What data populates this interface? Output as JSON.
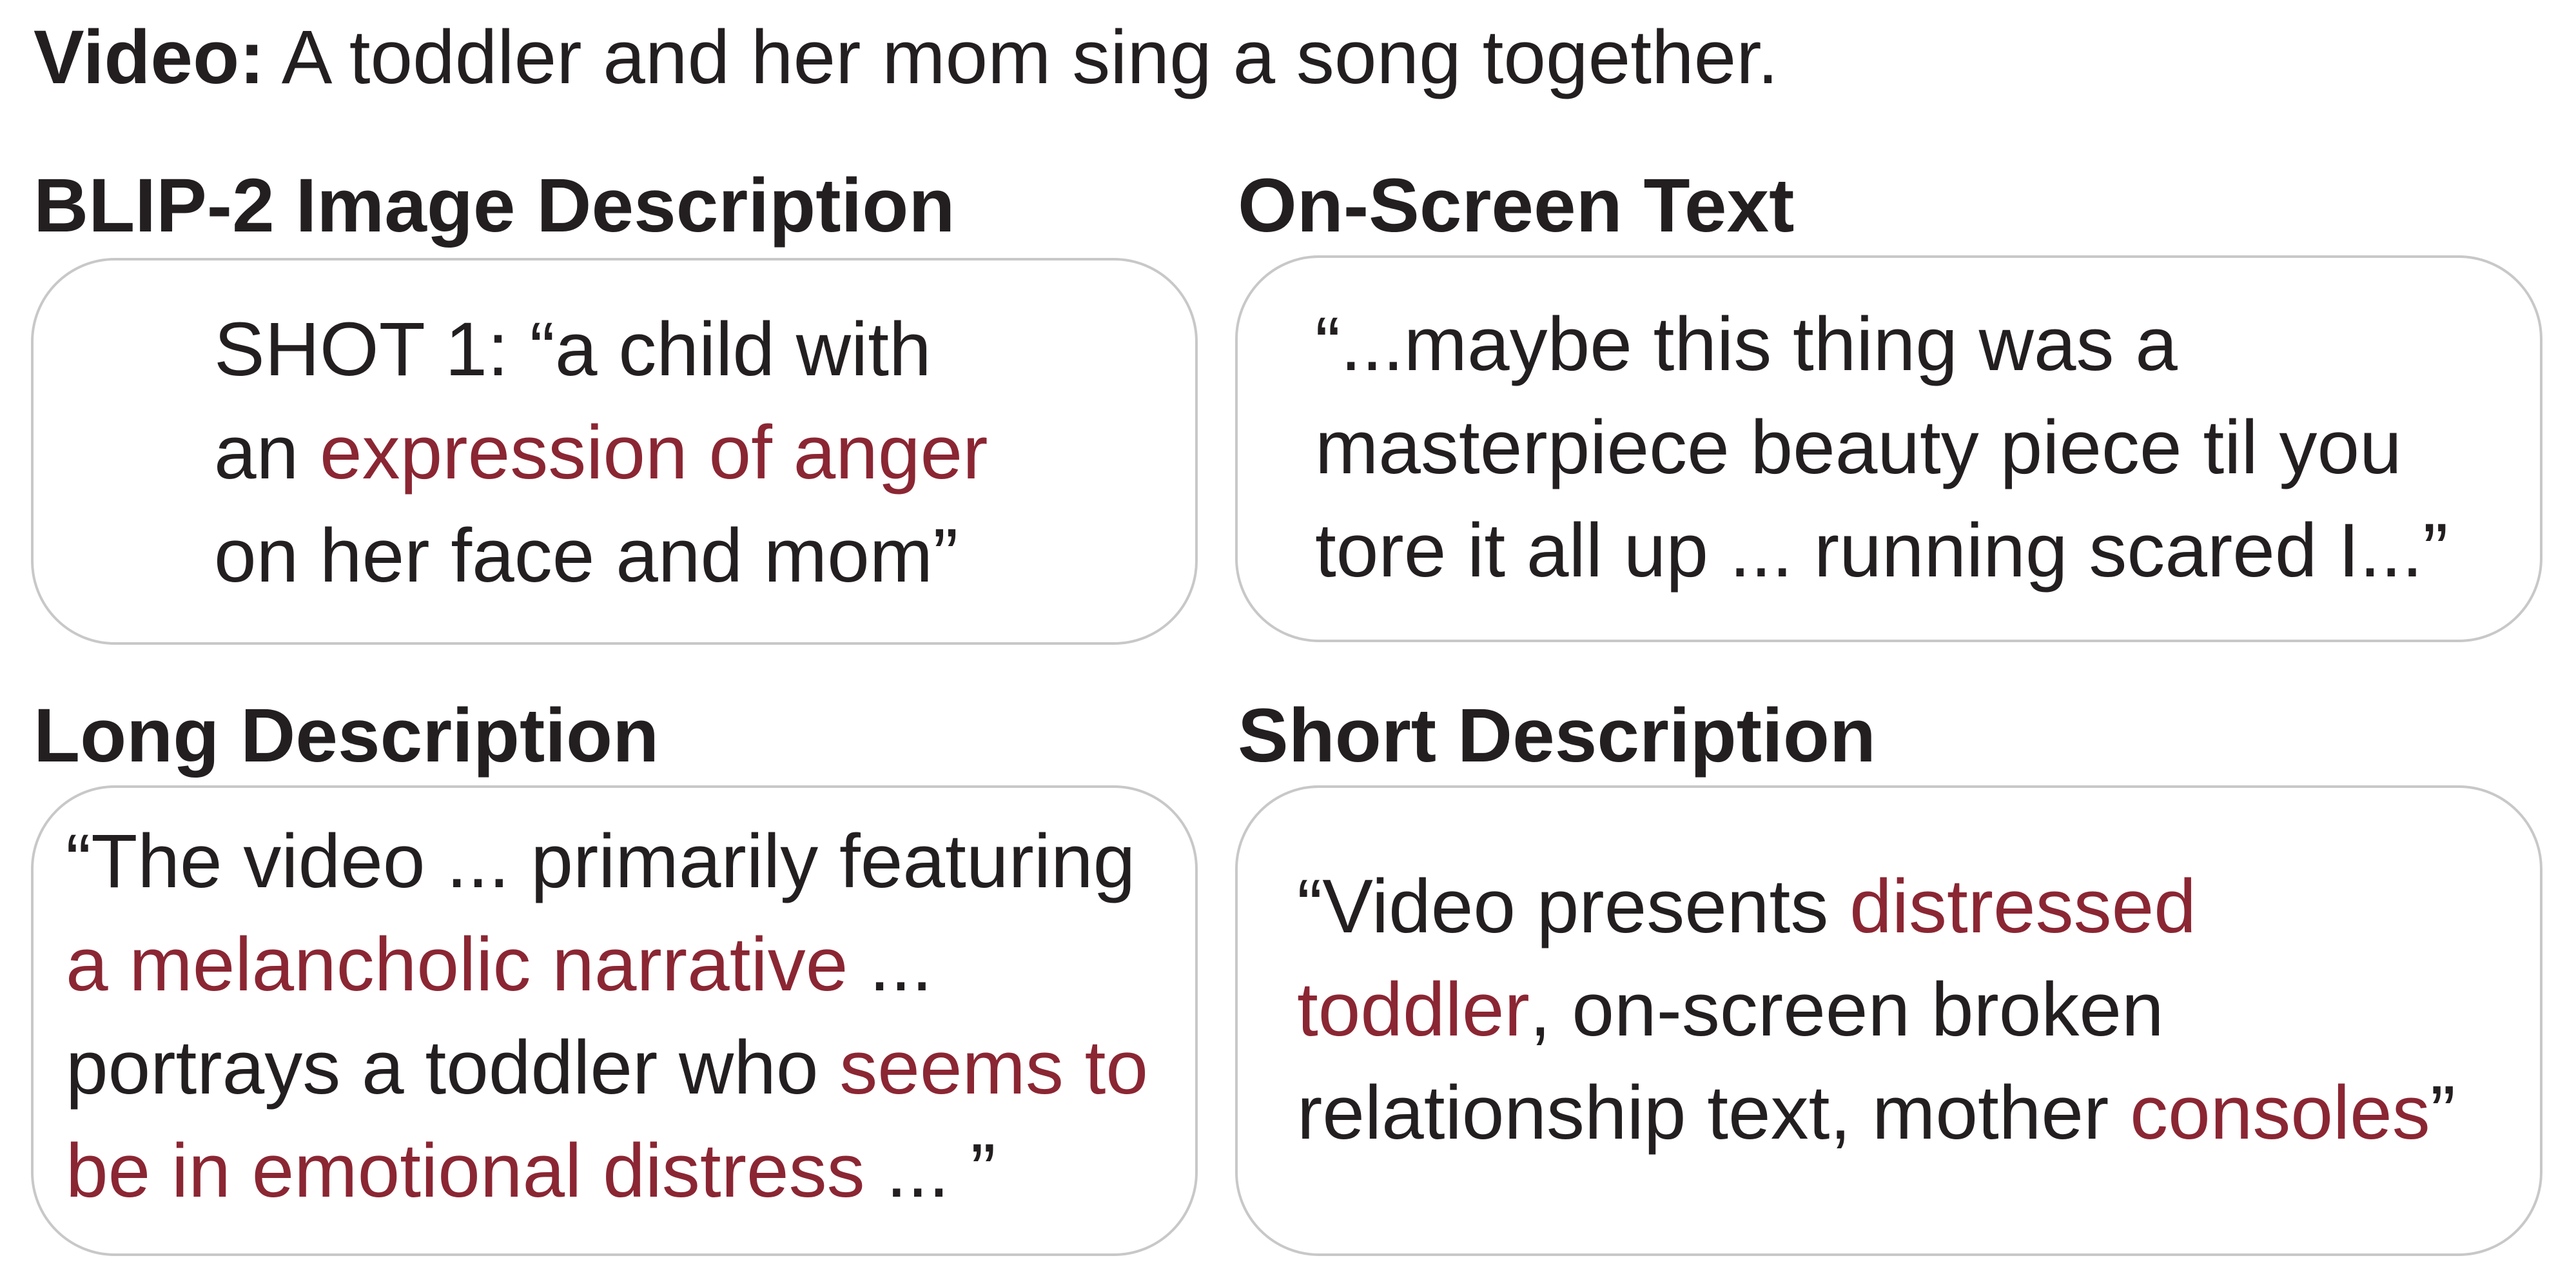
{
  "colors": {
    "text": "#231f20",
    "highlight": "#8b2633",
    "border": "#c8c8c8",
    "background": "#ffffff"
  },
  "video": {
    "label": "Video:",
    "text": " A toddler and her mom sing a song together."
  },
  "panels": {
    "blip": {
      "heading": "BLIP-2 Image Description",
      "lines": [
        [
          {
            "text": "SHOT 1: “a child with",
            "hl": false
          }
        ],
        [
          {
            "text": "an ",
            "hl": false
          },
          {
            "text": "expression of anger",
            "hl": true
          }
        ],
        [
          {
            "text": "on her face and mom”",
            "hl": false
          }
        ]
      ]
    },
    "onscreen": {
      "heading": "On-Screen Text",
      "lines": [
        [
          {
            "text": "“...maybe this thing was a",
            "hl": false
          }
        ],
        [
          {
            "text": "masterpiece beauty piece til you",
            "hl": false
          }
        ],
        [
          {
            "text": "tore it all up ... running scared I...”",
            "hl": false
          }
        ]
      ]
    },
    "long": {
      "heading": "Long Description",
      "lines": [
        [
          {
            "text": "“The video ... primarily featuring",
            "hl": false
          }
        ],
        [
          {
            "text": "a melancholic narrative",
            "hl": true
          },
          {
            "text": "  ...",
            "hl": false
          }
        ],
        [
          {
            "text": "portrays a toddler who ",
            "hl": false
          },
          {
            "text": "seems to",
            "hl": true
          }
        ],
        [
          {
            "text": "be in emotional distress",
            "hl": true
          },
          {
            "text": " ... ”",
            "hl": false
          }
        ]
      ]
    },
    "short": {
      "heading": "Short Description",
      "lines": [
        [
          {
            "text": "“Video presents ",
            "hl": false
          },
          {
            "text": "distressed",
            "hl": true
          }
        ],
        [
          {
            "text": "toddler",
            "hl": true
          },
          {
            "text": ", on-screen broken",
            "hl": false
          }
        ],
        [
          {
            "text": "relationship text, mother ",
            "hl": false
          },
          {
            "text": "consoles",
            "hl": true
          },
          {
            "text": "”",
            "hl": false
          }
        ]
      ]
    }
  }
}
